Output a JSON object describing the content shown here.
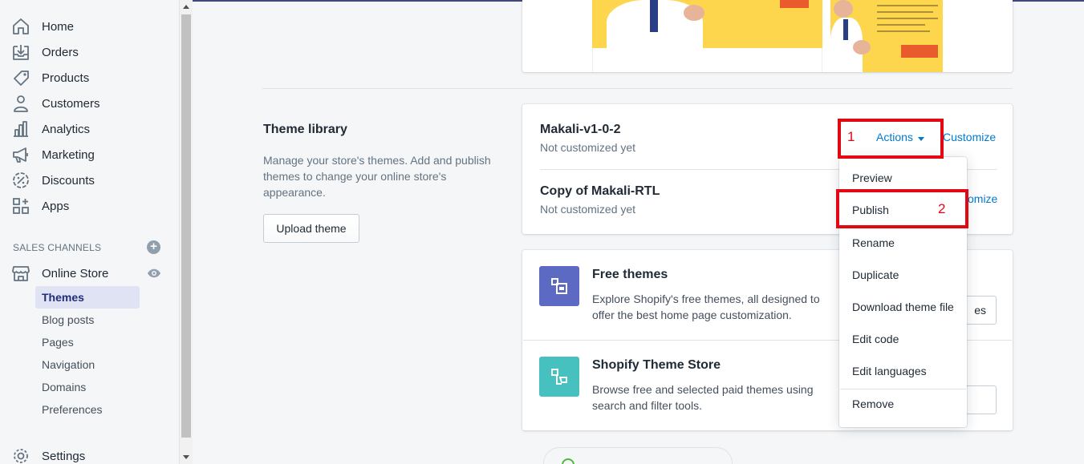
{
  "sidebar": {
    "items": [
      {
        "label": "Home",
        "icon": "home-icon"
      },
      {
        "label": "Orders",
        "icon": "orders-icon"
      },
      {
        "label": "Products",
        "icon": "tag-icon"
      },
      {
        "label": "Customers",
        "icon": "person-icon"
      },
      {
        "label": "Analytics",
        "icon": "bar-chart-icon"
      },
      {
        "label": "Marketing",
        "icon": "megaphone-icon"
      },
      {
        "label": "Discounts",
        "icon": "discount-icon"
      },
      {
        "label": "Apps",
        "icon": "apps-icon"
      }
    ],
    "sales_channels_title": "SALES CHANNELS",
    "online_store": "Online Store",
    "subitems": [
      "Themes",
      "Blog posts",
      "Pages",
      "Navigation",
      "Domains",
      "Preferences"
    ],
    "active_subitem": "Themes",
    "settings": "Settings"
  },
  "theme_library": {
    "title": "Theme library",
    "description": "Manage your store's themes. Add and publish themes to change your online store's appearance.",
    "upload_button": "Upload theme",
    "themes": [
      {
        "name": "Makali-v1-0-2",
        "status": "Not customized yet"
      },
      {
        "name": "Copy of Makali-RTL",
        "status": "Not customized yet"
      }
    ],
    "actions_label": "Actions",
    "customize_label": "Customize",
    "customize_partial": "omize"
  },
  "actions_menu": {
    "items": [
      "Preview",
      "Publish",
      "Rename",
      "Duplicate",
      "Download theme file",
      "Edit code",
      "Edit languages",
      "Remove"
    ]
  },
  "free_themes": {
    "title": "Free themes",
    "description": "Explore Shopify's free themes, all designed to offer the best home page customization.",
    "button_partial": "es"
  },
  "theme_store": {
    "title": "Shopify Theme Store",
    "description": "Browse free and selected paid themes using search and filter tools."
  },
  "annotations": [
    "1",
    "2"
  ],
  "colors": {
    "accent": "#007ace",
    "annotation_red": "#e30613",
    "free_themes_tile": "#5c6ac4",
    "theme_store_tile": "#47c1bf"
  }
}
